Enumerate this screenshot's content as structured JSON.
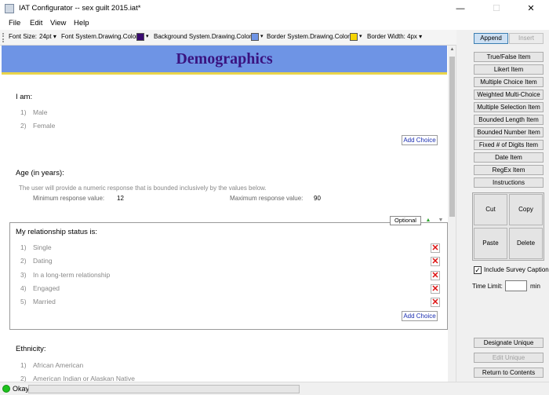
{
  "window": {
    "title": "IAT Configurator -- sex guilt 2015.iat*",
    "minimize": "—",
    "maximize": "☐",
    "close": "✕"
  },
  "menu": [
    "File",
    "Edit",
    "View",
    "Help"
  ],
  "toolbar": {
    "font_size_label": "Font Size:",
    "font_size_value": "24pt",
    "font_color_label": "Font System.Drawing.Color:",
    "bg_color_label": "Background System.Drawing.Color:",
    "border_color_label": "Border System.Drawing.Color:",
    "border_width_label": "Border Width:",
    "border_width_value": "4px",
    "colors": {
      "font": "#3a0a70",
      "background": "#6e94e5",
      "border": "#f5d400"
    }
  },
  "survey": {
    "title": "Demographics",
    "q1": {
      "prompt": "I am:",
      "options": [
        {
          "num": "1)",
          "text": "Male"
        },
        {
          "num": "2)",
          "text": "Female"
        }
      ],
      "add_choice": "Add Choice"
    },
    "q2": {
      "prompt": "Age (in years):",
      "note": "The user will provide a numeric response that is bounded inclusively by the values below.",
      "min_label": "Minimum response value:",
      "min_value": "12",
      "max_label": "Maximum response value:",
      "max_value": "90"
    },
    "q3": {
      "optional_tag": "Optional",
      "prompt": "My relationship status is:",
      "options": [
        {
          "num": "1)",
          "text": "Single"
        },
        {
          "num": "2)",
          "text": "Dating"
        },
        {
          "num": "3)",
          "text": "In a long-term relationship"
        },
        {
          "num": "4)",
          "text": "Engaged"
        },
        {
          "num": "5)",
          "text": "Married"
        }
      ],
      "add_choice": "Add Choice"
    },
    "q4": {
      "prompt": "Ethnicity:",
      "options": [
        {
          "num": "1)",
          "text": "African American"
        },
        {
          "num": "2)",
          "text": "American Indian or Alaskan Native"
        }
      ]
    }
  },
  "sidebar": {
    "append": "Append",
    "insert": "Insert",
    "item_types": [
      "True/False Item",
      "Likert Item",
      "Multiple Choice Item",
      "Weighted Multi-Choice",
      "Multiple Selection Item",
      "Bounded Length Item",
      "Bounded Number Item",
      "Fixed # of Digits Item",
      "Date Item",
      "RegEx Item",
      "Instructions"
    ],
    "clipboard": {
      "cut": "Cut",
      "copy": "Copy",
      "paste": "Paste",
      "delete": "Delete"
    },
    "include_caption": "Include Survey Caption",
    "include_caption_checked": true,
    "time_limit_label": "Time Limit:",
    "time_limit_value": "",
    "time_limit_unit": "min",
    "designate_unique": "Designate Unique",
    "edit_unique": "Edit Unique",
    "return": "Return to Contents"
  },
  "status": {
    "text": "Okay",
    "progress": 0
  }
}
